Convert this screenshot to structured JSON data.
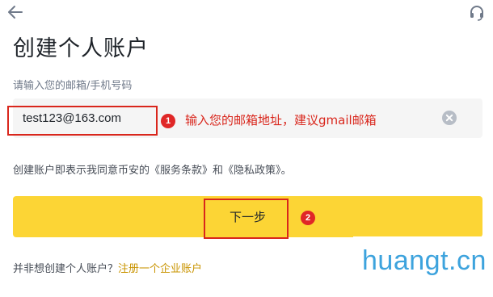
{
  "header": {
    "back_icon": "arrow-left-icon",
    "support_icon": "headset-icon"
  },
  "title": "创建个人账户",
  "email_field": {
    "label": "请输入您的邮箱/手机号码",
    "value": "test123@163.com",
    "clear_icon": "clear-circle-icon"
  },
  "annotations": {
    "step1_number": "1",
    "step1_text": "输入您的邮箱地址，建议gmail邮箱",
    "step2_number": "2",
    "color": "#d9261c"
  },
  "agreement": {
    "prefix": "创建账户即表示我同意币安的",
    "terms_link": "《服务条款》",
    "and": "和",
    "privacy_link": "《隐私政策》",
    "suffix": "。"
  },
  "next_button": {
    "label": "下一步",
    "color": "#fcd535"
  },
  "footer": {
    "question": "并非想创建个人账户？",
    "link": "注册一个企业账户",
    "link_color": "#c99400"
  },
  "watermark": "huangt.cn"
}
